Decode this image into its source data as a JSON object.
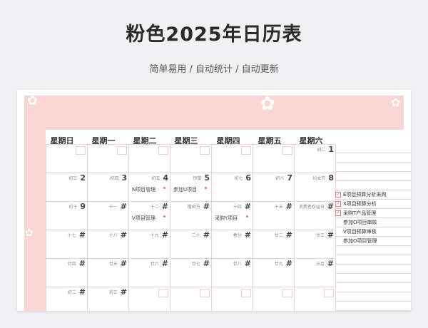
{
  "header": {
    "title": "粉色2025年日历表",
    "subtitle": "简单易用 / 自动统计 / 自动更新"
  },
  "weekdays": [
    "星期日",
    "星期一",
    "星期二",
    "星期三",
    "星期四",
    "星期五",
    "星期六"
  ],
  "weeks": [
    [
      {
        "lunar": "",
        "num": "",
        "ev": ""
      },
      {
        "lunar": "",
        "num": "",
        "ev": ""
      },
      {
        "lunar": "",
        "num": "",
        "ev": ""
      },
      {
        "lunar": "",
        "num": "",
        "ev": ""
      },
      {
        "lunar": "",
        "num": "",
        "ev": ""
      },
      {
        "lunar": "",
        "num": "",
        "ev": ""
      },
      {
        "lunar": "初二",
        "num": "1",
        "ev": ""
      }
    ],
    [
      {
        "lunar": "初三",
        "num": "2",
        "ev": ""
      },
      {
        "lunar": "初四",
        "num": "3",
        "ev": ""
      },
      {
        "lunar": "初五",
        "num": "4",
        "ev": "N项目管理"
      },
      {
        "lunar": "惊蛰",
        "num": "5",
        "ev": "参加U项目"
      },
      {
        "lunar": "初七",
        "num": "6",
        "ev": ""
      },
      {
        "lunar": "初八",
        "num": "7",
        "ev": ""
      },
      {
        "lunar": "妇女节",
        "num": "8",
        "ev": ""
      }
    ],
    [
      {
        "lunar": "初十",
        "num": "9",
        "ev": ""
      },
      {
        "lunar": "十一",
        "num": "#",
        "ev": ""
      },
      {
        "lunar": "十二",
        "num": "#",
        "ev": "V项目管理"
      },
      {
        "lunar": "植树节",
        "num": "#",
        "ev": ""
      },
      {
        "lunar": "十四",
        "num": "#",
        "ev": "采购Y项目"
      },
      {
        "lunar": "十五",
        "num": "#",
        "ev": ""
      },
      {
        "lunar": "消费者权益日",
        "num": "#",
        "ev": ""
      }
    ],
    [
      {
        "lunar": "十七",
        "num": "#",
        "ev": ""
      },
      {
        "lunar": "十八",
        "num": "#",
        "ev": ""
      },
      {
        "lunar": "十九",
        "num": "#",
        "ev": ""
      },
      {
        "lunar": "二十",
        "num": "#",
        "ev": ""
      },
      {
        "lunar": "春分",
        "num": "#",
        "ev": ""
      },
      {
        "lunar": "廿二",
        "num": "#",
        "ev": ""
      },
      {
        "lunar": "廿三",
        "num": "#",
        "ev": ""
      }
    ],
    [
      {
        "lunar": "廿四",
        "num": "#",
        "ev": ""
      },
      {
        "lunar": "廿五",
        "num": "#",
        "ev": ""
      },
      {
        "lunar": "廿六",
        "num": "#",
        "ev": ""
      },
      {
        "lunar": "廿七",
        "num": "#",
        "ev": ""
      },
      {
        "lunar": "廿八",
        "num": "#",
        "ev": ""
      },
      {
        "lunar": "廿九",
        "num": "#",
        "ev": ""
      },
      {
        "lunar": "三月",
        "num": "#",
        "ev": ""
      }
    ],
    [
      {
        "lunar": "初二",
        "num": "#",
        "ev": ""
      },
      {
        "lunar": "初三",
        "num": "#",
        "ev": ""
      },
      {
        "lunar": "",
        "num": "",
        "ev": ""
      },
      {
        "lunar": "",
        "num": "",
        "ev": ""
      },
      {
        "lunar": "",
        "num": "",
        "ev": ""
      },
      {
        "lunar": "",
        "num": "",
        "ev": ""
      },
      {
        "lunar": "",
        "num": "",
        "ev": ""
      }
    ]
  ],
  "event_dots": [
    [
      1,
      2
    ],
    [
      1,
      3
    ],
    [
      2,
      2
    ],
    [
      2,
      4
    ]
  ],
  "tasks": [
    {
      "label": "",
      "checked": false
    },
    {
      "label": "",
      "checked": false
    },
    {
      "label": "",
      "checked": false
    },
    {
      "label": "",
      "checked": false
    },
    {
      "label": "",
      "checked": false
    },
    {
      "label": "E项目预算分析采购",
      "checked": true
    },
    {
      "label": "X项目预算分析",
      "checked": true
    },
    {
      "label": "采购T产品管理",
      "checked": true
    },
    {
      "label": "参加O项目审核",
      "checked": false
    },
    {
      "label": "V项目预算审核",
      "checked": false
    },
    {
      "label": "参加O项目管理",
      "checked": false
    },
    {
      "label": "",
      "checked": false
    },
    {
      "label": "",
      "checked": false
    },
    {
      "label": "",
      "checked": false
    },
    {
      "label": "",
      "checked": false
    },
    {
      "label": "",
      "checked": false
    },
    {
      "label": "",
      "checked": false
    },
    {
      "label": "",
      "checked": false
    },
    {
      "label": "",
      "checked": false
    },
    {
      "label": "",
      "checked": false
    }
  ],
  "colors": {
    "frame": "#f9d6d4",
    "accent": "#e86a7a"
  }
}
